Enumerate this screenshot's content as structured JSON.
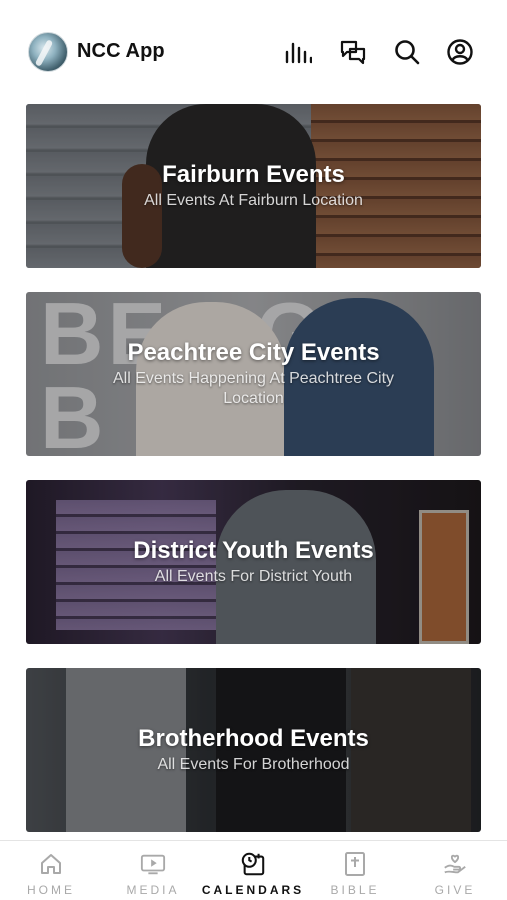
{
  "header": {
    "app_title": "NCC App",
    "icons": [
      "bars-chart-icon",
      "chat-bubbles-icon",
      "search-icon",
      "profile-icon"
    ]
  },
  "cards": [
    {
      "title": "Fairburn Events",
      "subtitle": "All Events At Fairburn Location"
    },
    {
      "title": "Peachtree City Events",
      "subtitle": "All Events Happening At Peachtree City Location"
    },
    {
      "title": "District Youth Events",
      "subtitle": "All Events For District Youth"
    },
    {
      "title": "Brotherhood Events",
      "subtitle": "All Events For Brotherhood"
    }
  ],
  "tabbar": {
    "items": [
      {
        "label": "HOME",
        "icon": "home-icon"
      },
      {
        "label": "MEDIA",
        "icon": "play-icon"
      },
      {
        "label": "CALENDARS",
        "icon": "calendar-icon"
      },
      {
        "label": "BIBLE",
        "icon": "bible-icon"
      },
      {
        "label": "GIVE",
        "icon": "give-hand-icon"
      }
    ],
    "active": "CALENDARS"
  },
  "colors": {
    "active_tab": "#111111",
    "inactive_tab": "#a9a9a9"
  }
}
